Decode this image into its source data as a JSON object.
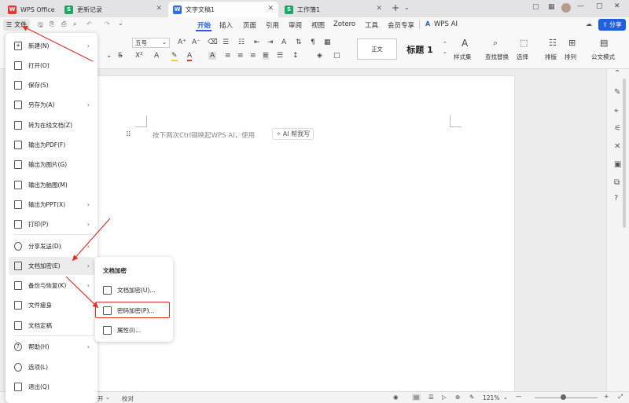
{
  "tabs": [
    {
      "label": "WPS Office",
      "icon": "wps-logo-icon"
    },
    {
      "label": "更新记录",
      "icon": "sheet-icon"
    },
    {
      "label": "文字文稿1",
      "icon": "doc-icon"
    },
    {
      "label": "工作簿1",
      "icon": "sheet-icon"
    }
  ],
  "ribbon": {
    "file_label": "文件",
    "tabs": [
      "开始",
      "插入",
      "页面",
      "引用",
      "审阅",
      "视图",
      "Zotero",
      "工具",
      "会员专享"
    ],
    "active_tab": "开始",
    "wps_ai": "WPS AI",
    "share": "分享"
  },
  "toolbar": {
    "font_size": "五号",
    "style_normal": "正文",
    "style_heading": "标题 1",
    "style_set": "样式集",
    "find_replace": "查找替换",
    "select": "选择",
    "sort": "排版",
    "arrange": "排列",
    "doc_mode": "公文模式"
  },
  "document": {
    "hint": "按下两次Ctrl键唤起WPS AI，使用",
    "ai_chip": "AI 帮我写"
  },
  "file_menu": {
    "items": [
      {
        "label": "新建(N)",
        "icon": "new-icon",
        "submenu": true
      },
      {
        "label": "打开(O)",
        "icon": "open-icon",
        "submenu": false
      },
      {
        "label": "保存(S)",
        "icon": "save-icon",
        "submenu": false
      },
      {
        "label": "另存为(A)",
        "icon": "save-as-icon",
        "submenu": true
      },
      {
        "label": "转为在线文档(Z)",
        "icon": "cloud-doc-icon",
        "submenu": false
      },
      {
        "label": "输出为PDF(F)",
        "icon": "pdf-icon",
        "submenu": false
      },
      {
        "label": "输出为图片(G)",
        "icon": "image-icon",
        "submenu": false
      },
      {
        "label": "输出为脑图(M)",
        "icon": "mindmap-icon",
        "submenu": false
      },
      {
        "label": "输出为PPT(X)",
        "icon": "ppt-icon",
        "submenu": true
      },
      {
        "label": "打印(P)",
        "icon": "print-icon",
        "submenu": true
      },
      {
        "label": "分享发送(D)",
        "icon": "share-icon",
        "submenu": true
      },
      {
        "label": "文档加密(E)",
        "icon": "encrypt-icon",
        "submenu": true
      },
      {
        "label": "备份与恢复(K)",
        "icon": "backup-icon",
        "submenu": true
      },
      {
        "label": "文件瘦身",
        "icon": "slim-icon",
        "submenu": false
      },
      {
        "label": "文档定稿",
        "icon": "finalize-icon",
        "submenu": false
      },
      {
        "label": "帮助(H)",
        "icon": "help-icon",
        "submenu": true
      },
      {
        "label": "选项(L)",
        "icon": "options-icon",
        "submenu": false
      },
      {
        "label": "退出(Q)",
        "icon": "exit-icon",
        "submenu": false
      }
    ]
  },
  "encrypt_submenu": {
    "title": "文档加密",
    "items": [
      {
        "label": "文档加密(U)...",
        "icon": "doc-lock-icon"
      },
      {
        "label": "密码加密(P)...",
        "icon": "password-icon"
      },
      {
        "label": "属性(I)...",
        "icon": "properties-icon"
      }
    ]
  },
  "statusbar": {
    "left_partial": "开",
    "proofread": "校对",
    "zoom": "121%"
  },
  "colors": {
    "accent": "#1f5fe0",
    "annotation": "#e0302b",
    "wps_red": "#e8352e",
    "sheet_green": "#21a366",
    "doc_blue": "#2f6fe4"
  }
}
